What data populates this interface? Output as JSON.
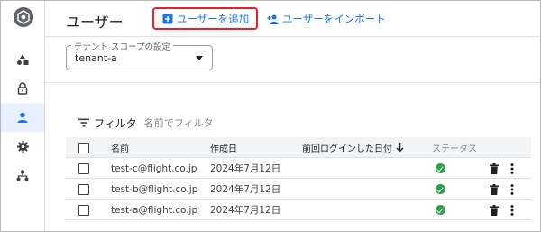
{
  "header": {
    "title": "ユーザー",
    "add_user_label": "ユーザーを追加",
    "import_users_label": "ユーザーをインポート"
  },
  "sidebar": {
    "items": [
      {
        "icon": "shapes-icon",
        "active": false
      },
      {
        "icon": "lock-icon",
        "active": false
      },
      {
        "icon": "user-icon",
        "active": true
      },
      {
        "icon": "gear-icon",
        "active": false
      },
      {
        "icon": "hierarchy-icon",
        "active": false
      }
    ]
  },
  "scope": {
    "legend": "テナント スコープの設定",
    "value": "tenant-a"
  },
  "filter": {
    "label": "フィルタ",
    "placeholder": "名前でフィルタ"
  },
  "table": {
    "columns": {
      "name": "名前",
      "created": "作成日",
      "last_login": "前回ログインした日付",
      "status": "ステータス"
    },
    "rows": [
      {
        "name": "test-c@flight.co.jp",
        "created": "2024年7月12日",
        "last_login": "",
        "status": "active"
      },
      {
        "name": "test-b@flight.co.jp",
        "created": "2024年7月12日",
        "last_login": "",
        "status": "active"
      },
      {
        "name": "test-a@flight.co.jp",
        "created": "2024年7月12日",
        "last_login": "",
        "status": "active"
      }
    ]
  },
  "colors": {
    "accent": "#1a73e8",
    "highlight_border": "#e8202a",
    "status_active": "#2e9e47",
    "active_nav_bg": "#e8f0fe"
  }
}
